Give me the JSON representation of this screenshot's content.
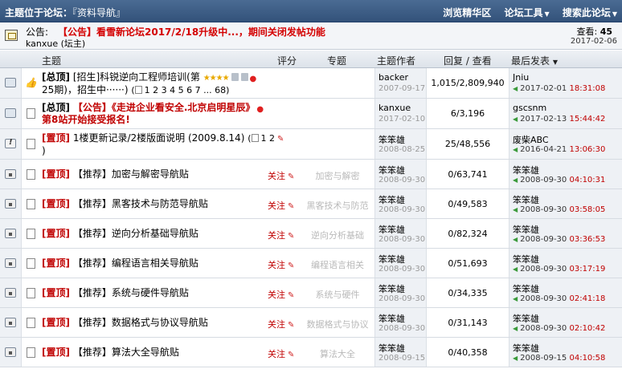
{
  "header": {
    "title_prefix": "主题位于论坛：",
    "forum_name": "『资料导航』",
    "menu": [
      "浏览精华区",
      "论坛工具",
      "搜索此论坛"
    ],
    "menu_arrows": [
      "",
      "▼",
      "▼"
    ]
  },
  "announcement": {
    "label": "公告:",
    "text": "【公告】看雪新论坛2017/2/18升级中...，期间关闭发帖功能",
    "user": "kanxue (坛主)",
    "views_label": "查看:",
    "views": "45",
    "date": "2017-02-06"
  },
  "columns": {
    "topic": "主题",
    "rating": "评分",
    "special": "专题",
    "author": "主题作者",
    "stats": "回复 / 查看",
    "last": "最后发表",
    "last_arrow": "▼"
  },
  "threads": [
    {
      "prefix": "[总顶]",
      "title": "[招生]科锐逆向工程师培训(第25期)，招生中······)",
      "title_line1": "[招生]科锐逆向工程师培训(第",
      "title_line2": "25期)，招生中······)",
      "pages": "1 2 3 4 5 6 7 ... 68",
      "author": "backer",
      "author_date": "2007-09-17",
      "stats": "1,015/2,809,940",
      "last_user": "Jniu",
      "last_date": "2017-02-01",
      "last_time": "18:31:08"
    },
    {
      "prefix": "[总顶]",
      "title_line1": "【公告】《走进企业看安全.北京启明星辰》",
      "title_line2": "第8站开始接受报名!",
      "author": "kanxue",
      "author_date": "2017-02-10",
      "stats": "6/3,196",
      "last_user": "gscsnm",
      "last_date": "2017-02-13",
      "last_time": "15:44:42"
    },
    {
      "prefix": "[置顶]",
      "title_line1": "1楼更新记录/2楼版面说明 (2009.8.14)",
      "title_line2": ")",
      "pages": "1 2",
      "author": "笨笨雄",
      "author_date": "2008-08-25",
      "stats": "25/48,556",
      "last_user": "废柴ABC",
      "last_date": "2016-04-21",
      "last_time": "13:06:30"
    },
    {
      "prefix": "[置顶]",
      "title": "【推荐】加密与解密导航贴",
      "follow": "关注",
      "special": "加密与解密",
      "author": "笨笨雄",
      "author_date": "2008-09-30",
      "stats": "0/63,741",
      "last_user": "笨笨雄",
      "last_date": "2008-09-30",
      "last_time": "04:10:31"
    },
    {
      "prefix": "[置顶]",
      "title": "【推荐】黑客技术与防范导航贴",
      "follow": "关注",
      "special": "黑客技术与防范",
      "author": "笨笨雄",
      "author_date": "2008-09-30",
      "stats": "0/49,583",
      "last_user": "笨笨雄",
      "last_date": "2008-09-30",
      "last_time": "03:58:05"
    },
    {
      "prefix": "[置顶]",
      "title": "【推荐】逆向分析基础导航贴",
      "follow": "关注",
      "special": "逆向分析基础",
      "author": "笨笨雄",
      "author_date": "2008-09-30",
      "stats": "0/82,324",
      "last_user": "笨笨雄",
      "last_date": "2008-09-30",
      "last_time": "03:36:53"
    },
    {
      "prefix": "[置顶]",
      "title": "【推荐】编程语言相关导航贴",
      "follow": "关注",
      "special": "编程语言相关",
      "author": "笨笨雄",
      "author_date": "2008-09-30",
      "stats": "0/51,693",
      "last_user": "笨笨雄",
      "last_date": "2008-09-30",
      "last_time": "03:17:19"
    },
    {
      "prefix": "[置顶]",
      "title": "【推荐】系统与硬件导航贴",
      "follow": "关注",
      "special": "系统与硬件",
      "author": "笨笨雄",
      "author_date": "2008-09-30",
      "stats": "0/34,335",
      "last_user": "笨笨雄",
      "last_date": "2008-09-30",
      "last_time": "02:41:18"
    },
    {
      "prefix": "[置顶]",
      "title": "【推荐】数据格式与协议导航贴",
      "follow": "关注",
      "special": "数据格式与协议",
      "author": "笨笨雄",
      "author_date": "2008-09-30",
      "stats": "0/31,143",
      "last_user": "笨笨雄",
      "last_date": "2008-09-30",
      "last_time": "02:10:42"
    },
    {
      "prefix": "[置顶]",
      "title": "【推荐】算法大全导航贴",
      "follow": "关注",
      "special": "算法大全",
      "author": "笨笨雄",
      "author_date": "2008-09-15",
      "stats": "0/40,358",
      "last_user": "笨笨雄",
      "last_date": "2008-09-15",
      "last_time": "04:10:58"
    }
  ]
}
